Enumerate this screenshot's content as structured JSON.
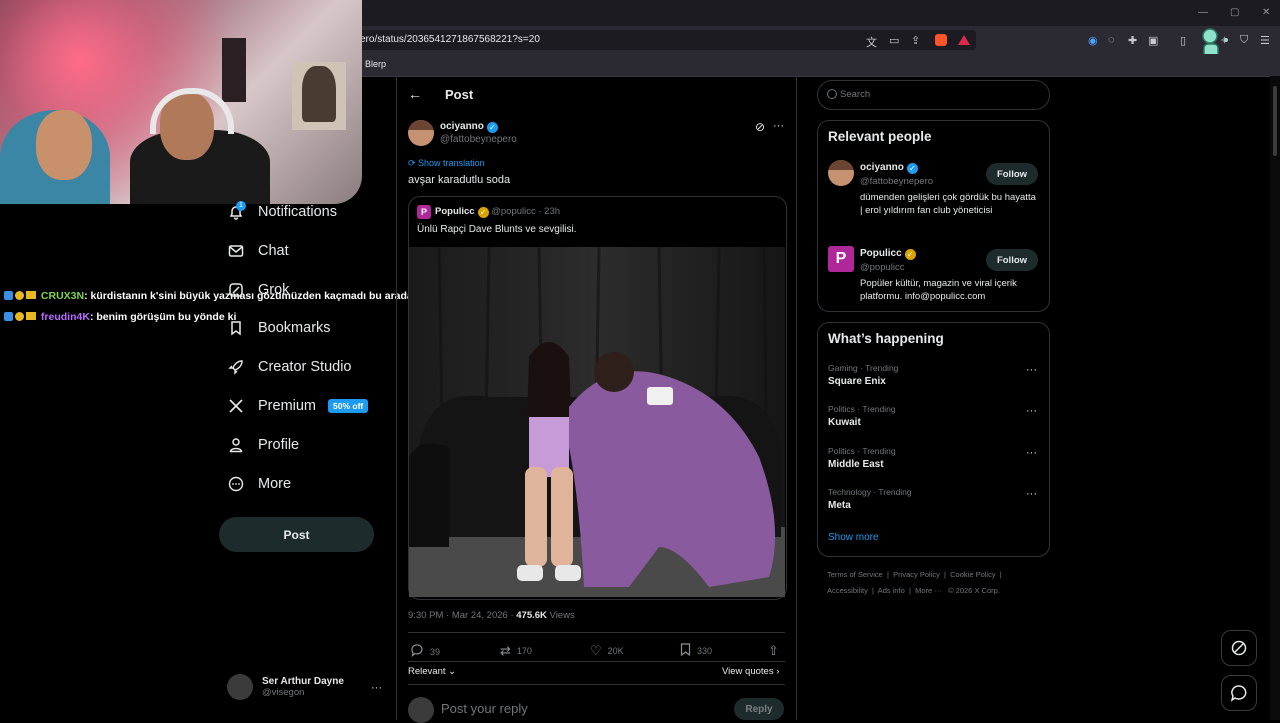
{
  "browser": {
    "url": "ero/status/2036541271867568221?s=20",
    "bookmark": "Blerp"
  },
  "chat": [
    {
      "user": "CRUX3N",
      "user_color": "#7fd44a",
      "message": ": kürdistanın k'sini büyük yazması gözümüzden kaçmadı bu arada"
    },
    {
      "user": "freudin4K",
      "user_color": "#b86bff",
      "message": ": benim görüşüm bu yönde ki"
    }
  ],
  "nav": {
    "items": [
      {
        "label": "Notifications",
        "icon": "bell-icon",
        "badge": "1"
      },
      {
        "label": "Chat",
        "icon": "mail-icon"
      },
      {
        "label": "Grok",
        "icon": "grok-icon"
      },
      {
        "label": "Bookmarks",
        "icon": "bookmark-icon"
      },
      {
        "label": "Creator Studio",
        "icon": "rocket-icon"
      },
      {
        "label": "Premium",
        "icon": "x-icon"
      },
      {
        "label": "Profile",
        "icon": "person-icon"
      },
      {
        "label": "More",
        "icon": "more-circle-icon"
      }
    ],
    "premium_badge": "50% off",
    "post_button": "Post"
  },
  "account": {
    "name": "Ser Arthur Dayne",
    "handle": "@visegon"
  },
  "post": {
    "header": "Post",
    "author_name": "ociyanno",
    "author_handle": "@fattobeynepero",
    "show_translation": "Show translation",
    "text": "avşar karadutlu soda",
    "quote": {
      "name": "Populicc",
      "handle": "@populicc",
      "time": "· 23h",
      "text": "Ünlü Rapçi Dave Blunts ve sevgilisi."
    },
    "timestamp": "9:30 PM · Mar 24, 2026 · ",
    "views_count": "475.6K",
    "views_label": " Views",
    "actions": {
      "replies": "39",
      "reposts": "170",
      "likes": "20K",
      "bookmarks": "330"
    },
    "relevant": "Relevant",
    "view_quotes": "View quotes",
    "reply_placeholder": "Post your reply",
    "reply_button": "Reply"
  },
  "sidebar": {
    "search_placeholder": "Search",
    "relevant_title": "Relevant people",
    "people": [
      {
        "name": "ociyanno",
        "handle": "@fattobeynepero",
        "bio": "dümenden gelişleri çok gördük bu hayatta | erol yıldırım fan club yöneticisi",
        "follow": "Follow"
      },
      {
        "name": "Populicc",
        "handle": "@populicc",
        "bio": "Popüler kültür, magazin ve viral içerik platformu. info@populicc.com",
        "follow": "Follow"
      }
    ],
    "happening_title": "What’s happening",
    "trends": [
      {
        "category": "Gaming · Trending",
        "name": "Square Enix"
      },
      {
        "category": "Politics · Trending",
        "name": "Kuwait"
      },
      {
        "category": "Politics · Trending",
        "name": "Middle East"
      },
      {
        "category": "Technology · Trending",
        "name": "Meta"
      }
    ],
    "show_more": "Show more",
    "footer": [
      "Terms of Service",
      "Privacy Policy",
      "Cookie Policy",
      "Accessibility",
      "Ads info",
      "More ···",
      "© 2026 X Corp."
    ]
  }
}
